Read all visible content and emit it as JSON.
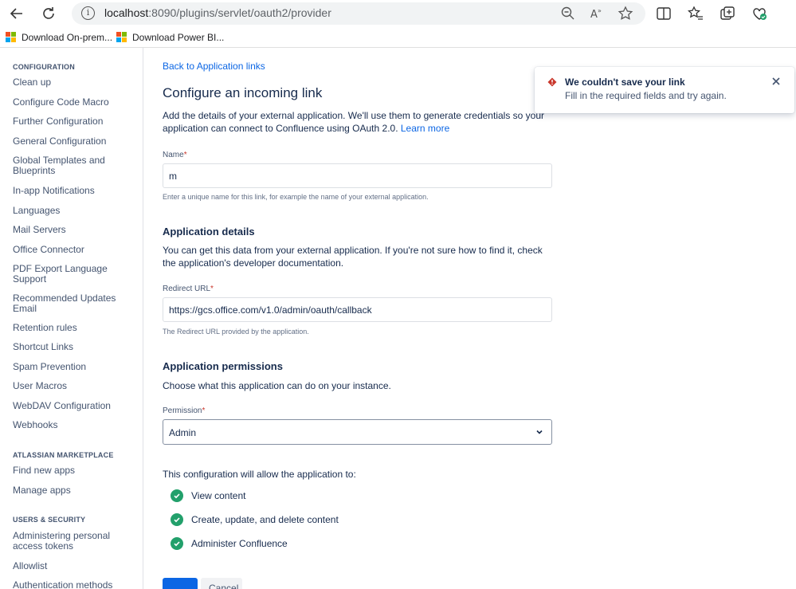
{
  "browser": {
    "url_host": "localhost",
    "url_path": ":8090/plugins/servlet/oauth2/provider",
    "bookmarks": [
      "Download On-prem...",
      "Download Power BI..."
    ]
  },
  "sidebar": {
    "sections": [
      {
        "heading": "CONFIGURATION",
        "items": [
          "Clean up",
          "Configure Code Macro",
          "Further Configuration",
          "General Configuration",
          "Global Templates and Blueprints",
          "In-app Notifications",
          "Languages",
          "Mail Servers",
          "Office Connector",
          "PDF Export Language Support",
          "Recommended Updates Email",
          "Retention rules",
          "Shortcut Links",
          "Spam Prevention",
          "User Macros",
          "WebDAV Configuration",
          "Webhooks"
        ]
      },
      {
        "heading": "ATLASSIAN MARKETPLACE",
        "items": [
          "Find new apps",
          "Manage apps"
        ]
      },
      {
        "heading": "USERS & SECURITY",
        "items": [
          "Administering personal access tokens",
          "Allowlist",
          "Authentication methods"
        ]
      }
    ]
  },
  "main": {
    "back_link": "Back to Application links",
    "title": "Configure an incoming link",
    "intro": "Add the details of your external application. We'll use them to generate credentials so your application can connect to Confluence using OAuth 2.0.",
    "learn_more": "Learn more",
    "name_label": "Name",
    "name_value": "m",
    "name_help": "Enter a unique name for this link, for example the name of your external application.",
    "app_details_title": "Application details",
    "app_details_desc": "You can get this data from your external application. If you're not sure how to find it, check the application's developer documentation.",
    "redirect_label": "Redirect URL",
    "redirect_value": "https://gcs.office.com/v1.0/admin/oauth/callback",
    "redirect_help": "The Redirect URL provided by the application.",
    "permissions_title": "Application permissions",
    "permissions_desc": "Choose what this application can do on your instance.",
    "permission_label": "Permission",
    "permission_value": "Admin",
    "allow_title": "This configuration will allow the application to:",
    "allowed": [
      "View content",
      "Create, update, and delete content",
      "Administer Confluence"
    ],
    "cancel_label": "Cancel"
  },
  "flag": {
    "title": "We couldn't save your link",
    "description": "Fill in the required fields and try again."
  },
  "colors": {
    "link": "#0c66e4",
    "success": "#22a06b",
    "error": "#c9372c"
  }
}
